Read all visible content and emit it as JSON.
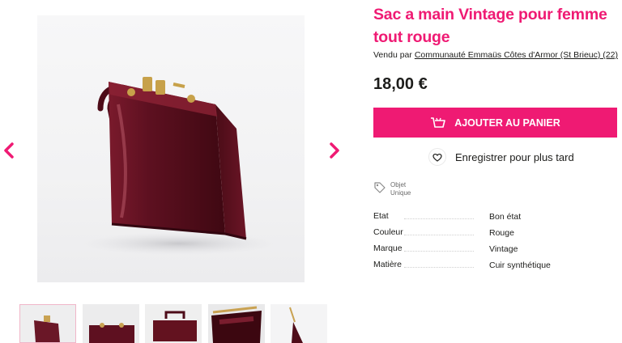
{
  "product": {
    "title": "Sac a main Vintage pour femme tout rouge",
    "seller_prefix": "Vendu par",
    "seller_name": "Communauté Emmaüs Côtes d'Armor (St Brieuc) (22)",
    "price": "18,00 €",
    "add_to_cart": "AJOUTER AU PANIER",
    "save_later": "Enregistrer pour plus tard",
    "badge_line1": "Objet",
    "badge_line2": "Unique"
  },
  "specs": [
    {
      "label": "Etat",
      "value": "Bon état"
    },
    {
      "label": "Couleur",
      "value": "Rouge"
    },
    {
      "label": "Marque",
      "value": "Vintage"
    },
    {
      "label": "Matière",
      "value": "Cuir synthétique"
    }
  ],
  "gallery": {
    "thumbnail_count": 5,
    "active_index": 0
  },
  "colors": {
    "accent": "#ef1a73",
    "bag": "#5a0f1e",
    "text": "#1d1d1b"
  },
  "icons": [
    "chevron-left-icon",
    "chevron-right-icon",
    "cart-icon",
    "heart-icon",
    "tag-icon"
  ]
}
